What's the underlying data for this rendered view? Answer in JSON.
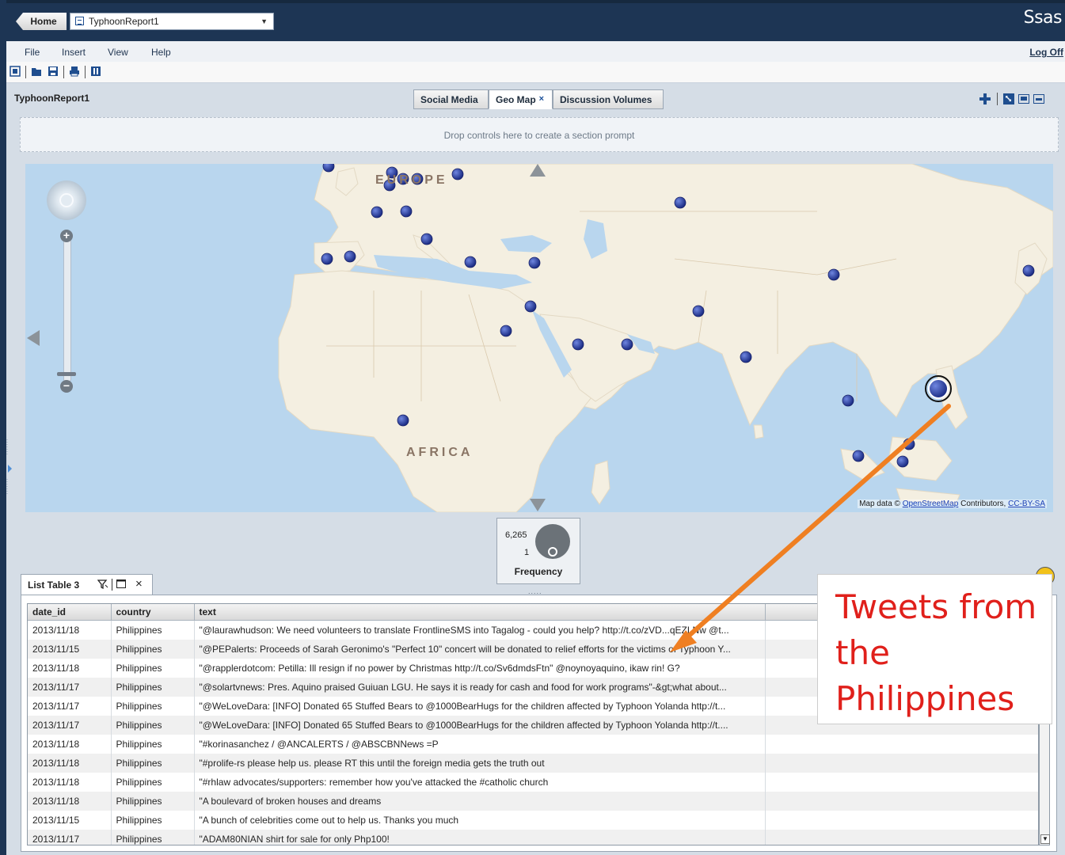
{
  "header": {
    "home_label": "Home",
    "report_name": "TyphoonReport1",
    "brand": "Ssas"
  },
  "menu": {
    "items": [
      "File",
      "Insert",
      "View",
      "Help"
    ],
    "logoff_label": "Log Off"
  },
  "toolbar": {
    "icons": [
      "new-report-icon",
      "open-icon",
      "save-icon",
      "print-icon",
      "screen-mode-icon"
    ]
  },
  "report": {
    "title": "TyphoonReport1",
    "tabs": [
      {
        "label": "Social Media",
        "active": false
      },
      {
        "label": "Geo Map",
        "active": true,
        "close": "×"
      },
      {
        "label": "Discussion Volumes",
        "active": false
      }
    ],
    "prompt_placeholder": "Drop controls here to create a section prompt"
  },
  "map": {
    "continent_labels": [
      "EUROPE",
      "AFRICA"
    ],
    "attribution_prefix": "Map data ©",
    "attribution_link1": "OpenStreetMap",
    "attribution_mid": "Contributors,",
    "attribution_link2": "CC-BY-SA",
    "marker_color": "#2c3e9c",
    "water_color": "#b9d6ee",
    "land_color": "#f4efe1"
  },
  "legend": {
    "max_value": "6,265",
    "min_value": "1",
    "label": "Frequency",
    "dots": "....."
  },
  "list_table": {
    "tab_label": "List Table 3",
    "columns": [
      "date_id",
      "country",
      "text"
    ],
    "rows": [
      [
        "2013/11/18",
        "Philippines",
        "\"@laurawhudson: We need volunteers to translate FrontlineSMS into Tagalog - could you help? http://t.co/zVD...qEZLNw @t..."
      ],
      [
        "2013/11/15",
        "Philippines",
        "\"@PEPalerts: Proceeds of Sarah Geronimo's \"Perfect 10\" concert will be donated to relief efforts for the victims of Typhoon Y..."
      ],
      [
        "2013/11/18",
        "Philippines",
        "\"@rapplerdotcom: Petilla: Ill resign if no power by Christmas http://t.co/Sv6dmdsFtn\" @noynoyaquino, ikaw rin! G?"
      ],
      [
        "2013/11/17",
        "Philippines",
        "\"@solartvnews: Pres. Aquino praised Guiuan LGU. He says it is ready for cash and food for work programs\"-&gt;what about..."
      ],
      [
        "2013/11/17",
        "Philippines",
        "\"@WeLoveDara: [INFO] Donated 65 Stuffed Bears to @1000BearHugs for the children affected by Typhoon Yolanda http://t..."
      ],
      [
        "2013/11/17",
        "Philippines",
        "\"@WeLoveDara: [INFO] Donated 65 Stuffed Bears to @1000BearHugs for the children affected by Typhoon Yolanda http://t...."
      ],
      [
        "2013/11/18",
        "Philippines",
        "\"#korinasanchez / @ANCALERTS / @ABSCBNNews =P"
      ],
      [
        "2013/11/18",
        "Philippines",
        "\"#prolife-rs please help us.  please RT this until the foreign media gets the truth out"
      ],
      [
        "2013/11/18",
        "Philippines",
        "\"#rhlaw advocates/supporters:  remember how you've attacked the #catholic church"
      ],
      [
        "2013/11/18",
        "Philippines",
        "\"A boulevard of broken houses and dreams"
      ],
      [
        "2013/11/15",
        "Philippines",
        "\"A bunch of celebrities come out to help us. Thanks you much"
      ],
      [
        "2013/11/17",
        "Philippines",
        "\"ADAM80NIAN shirt for sale for only Php100!"
      ]
    ]
  },
  "annotation": {
    "text": "Tweets from the Philippines",
    "color": "#e0201b",
    "arrow_color": "#ef7f22"
  }
}
